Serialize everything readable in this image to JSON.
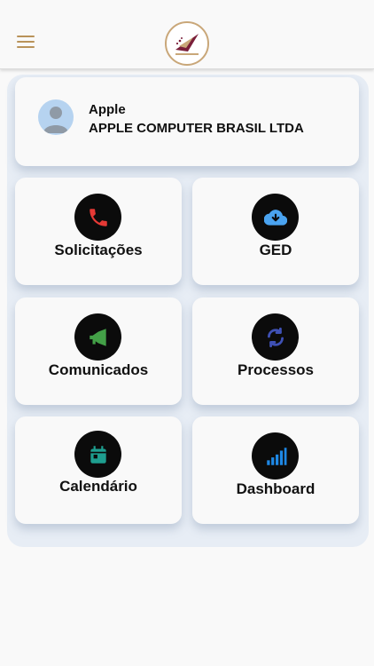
{
  "header": {
    "menu_icon": "hamburger-menu-icon",
    "logo_icon": "company-logo"
  },
  "profile": {
    "name": "Apple",
    "company": "APPLE COMPUTER BRASIL LTDA",
    "avatar_icon": "user-avatar-icon"
  },
  "tiles": [
    {
      "label": "Solicitações",
      "icon": "phone-icon",
      "icon_color": "#e53935"
    },
    {
      "label": "GED",
      "icon": "cloud-download-icon",
      "icon_color": "#4aa3f0"
    },
    {
      "label": "Comunicados",
      "icon": "megaphone-icon",
      "icon_color": "#43a047"
    },
    {
      "label": "Processos",
      "icon": "sync-icon",
      "icon_color": "#3f51b5"
    },
    {
      "label": "Calendário",
      "icon": "calendar-icon",
      "icon_color": "#1e9e8f"
    },
    {
      "label": "Dashboard",
      "icon": "signal-bars-icon",
      "icon_color": "#1e88e5"
    }
  ],
  "colors": {
    "accent": "#b9935a",
    "panel": "#e7edf5",
    "card": "#f9f9f9"
  }
}
